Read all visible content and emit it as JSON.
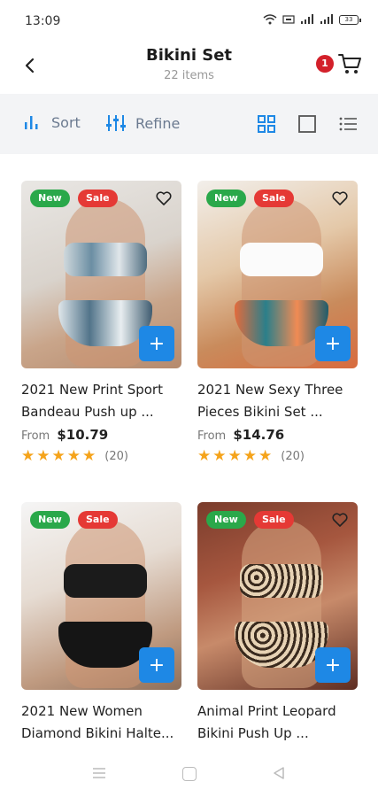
{
  "status_bar": {
    "time": "13:09",
    "battery": "33"
  },
  "header": {
    "title": "Bikini Set",
    "subtitle": "22 items",
    "cart_count": "1"
  },
  "toolbar": {
    "sort_label": "Sort",
    "refine_label": "Refine"
  },
  "colors": {
    "accent": "#1e88e5",
    "new_badge": "#2aa84a",
    "sale_badge": "#e53935",
    "star": "#f5a31a",
    "cart_badge": "#d3202a"
  },
  "products": [
    {
      "badge_new": "New",
      "badge_sale": "Sale",
      "title": "2021 New Print Sport Bandeau Push up ...",
      "price_prefix": "From",
      "price": "$10.79",
      "reviews": "(20)",
      "rating": 5,
      "add_label": "+"
    },
    {
      "badge_new": "New",
      "badge_sale": "Sale",
      "title": "2021 New Sexy Three Pieces Bikini Set ...",
      "price_prefix": "From",
      "price": "$14.76",
      "reviews": "(20)",
      "rating": 5,
      "add_label": "+"
    },
    {
      "badge_new": "New",
      "badge_sale": "Sale",
      "title": "2021 New Women Diamond Bikini Halte...",
      "add_label": "+"
    },
    {
      "badge_new": "New",
      "badge_sale": "Sale",
      "title": "Animal Print Leopard Bikini Push Up ...",
      "add_label": "+"
    }
  ],
  "icons": [
    "back-arrow-icon",
    "cart-icon",
    "sort-bars-icon",
    "sliders-icon",
    "grid-view-icon",
    "single-view-icon",
    "list-view-icon",
    "heart-icon",
    "plus-icon",
    "menu-icon",
    "home-icon",
    "back-triangle-icon"
  ]
}
